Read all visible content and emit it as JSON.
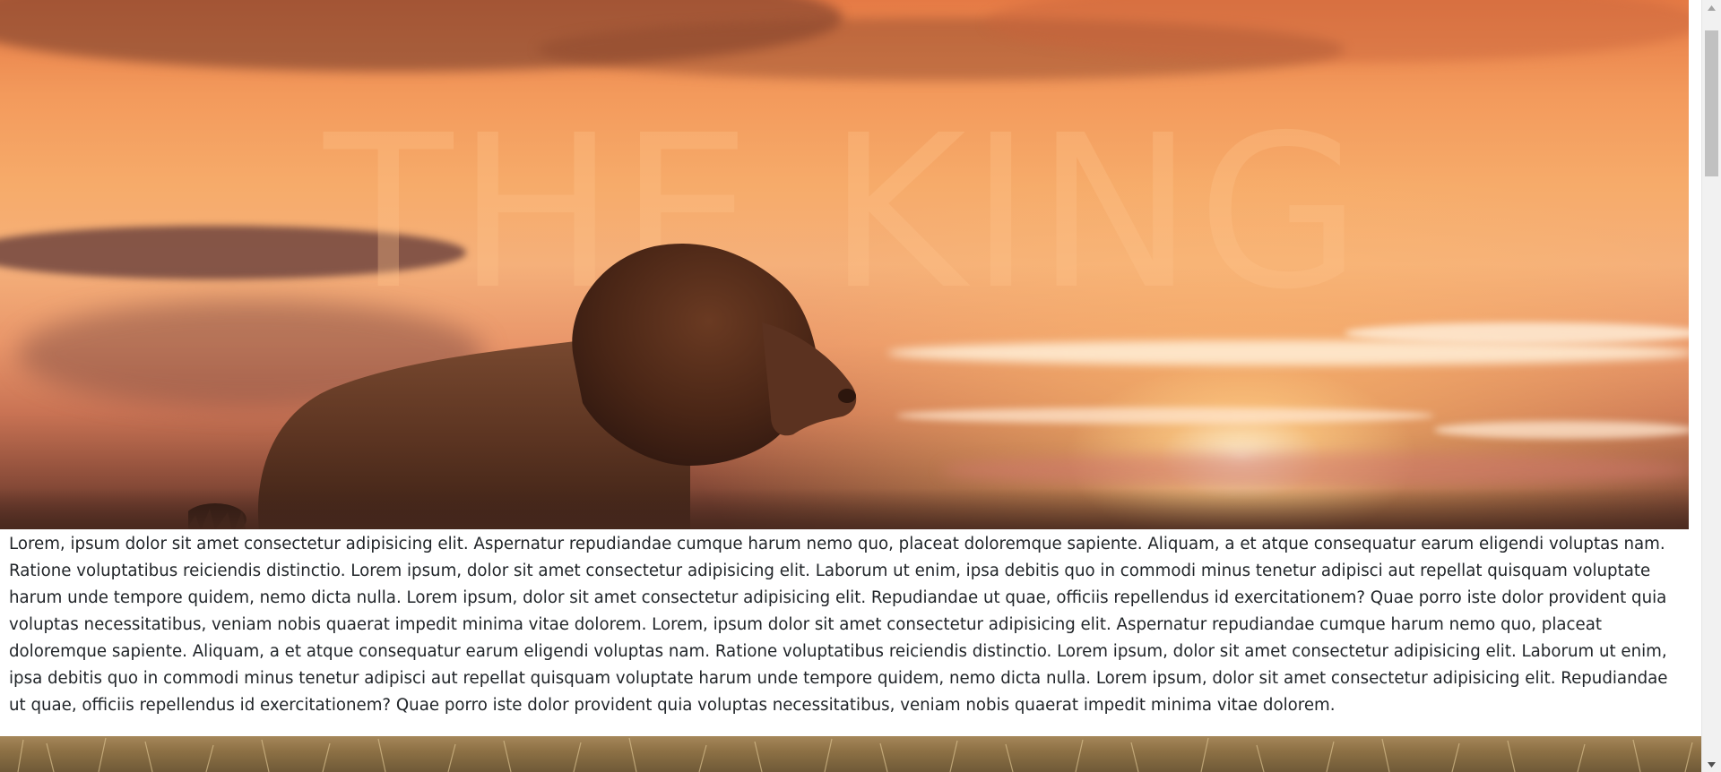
{
  "hero": {
    "watermark": "THE KING"
  },
  "content": {
    "paragraph": "Lorem, ipsum dolor sit amet consectetur adipisicing elit. Aspernatur repudiandae cumque harum nemo quo, placeat doloremque sapiente. Aliquam, a et atque consequatur earum eligendi voluptas nam. Ratione voluptatibus reiciendis distinctio. Lorem ipsum, dolor sit amet consectetur adipisicing elit. Laborum ut enim, ipsa debitis quo in commodi minus tenetur adipisci aut repellat quisquam voluptate harum unde tempore quidem, nemo dicta nulla. Lorem ipsum, dolor sit amet consectetur adipisicing elit. Repudiandae ut quae, officiis repellendus id exercitationem? Quae porro iste dolor provident quia voluptas necessitatibus, veniam nobis quaerat impedit minima vitae dolorem. Lorem, ipsum dolor sit amet consectetur adipisicing elit. Aspernatur repudiandae cumque harum nemo quo, placeat doloremque sapiente. Aliquam, a et atque consequatur earum eligendi voluptas nam. Ratione voluptatibus reiciendis distinctio. Lorem ipsum, dolor sit amet consectetur adipisicing elit. Laborum ut enim, ipsa debitis quo in commodi minus tenetur adipisci aut repellat quisquam voluptate harum unde tempore quidem, nemo dicta nulla. Lorem ipsum, dolor sit amet consectetur adipisicing elit. Repudiandae ut quae, officiis repellendus id exercitationem? Quae porro iste dolor provident quia voluptas necessitatibus, veniam nobis quaerat impedit minima vitae dolorem."
  },
  "icons": {
    "scroll_up": "triangle-up-icon",
    "scroll_down": "triangle-down-icon"
  },
  "colors": {
    "text": "#212529",
    "scrollbar_track": "#f1f1f1",
    "scrollbar_thumb": "#c1c1c1"
  }
}
